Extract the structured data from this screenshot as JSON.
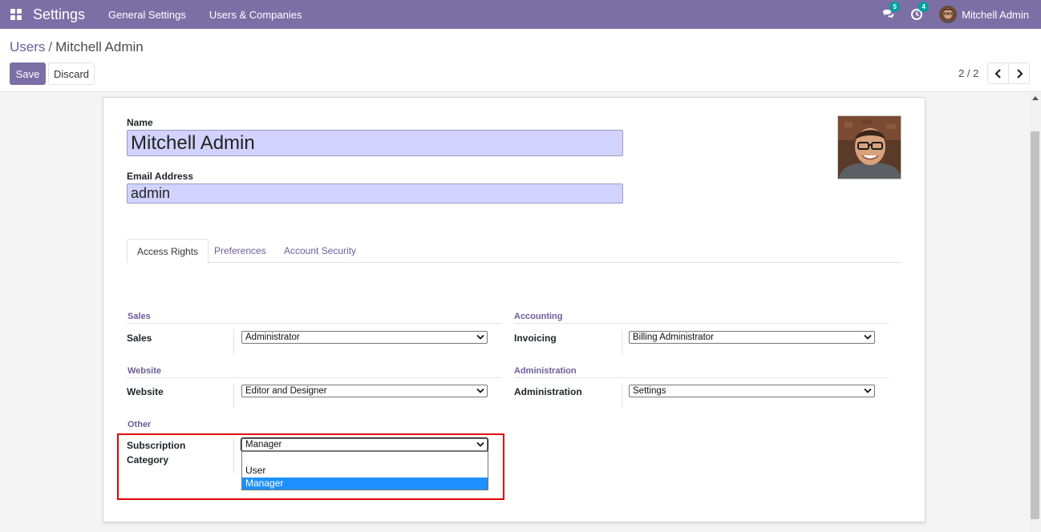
{
  "navbar": {
    "app_title": "Settings",
    "menus": [
      "General Settings",
      "Users & Companies"
    ],
    "messages_badge": "5",
    "activities_badge": "4",
    "user_name": "Mitchell Admin",
    "bg_color": "#7c6fa6"
  },
  "breadcrumb": {
    "parent": "Users",
    "separator": "/",
    "current": "Mitchell Admin"
  },
  "buttons": {
    "save": "Save",
    "discard": "Discard"
  },
  "pager": {
    "value": "2 / 2"
  },
  "form": {
    "name_label": "Name",
    "name_value": "Mitchell Admin",
    "email_label": "Email Address",
    "email_value": "admin"
  },
  "tabs": [
    "Access Rights",
    "Preferences",
    "Account Security"
  ],
  "groups": {
    "sales": {
      "title": "Sales",
      "label": "Sales",
      "value": "Administrator"
    },
    "accounting": {
      "title": "Accounting",
      "label": "Invoicing",
      "value": "Billing Administrator"
    },
    "website": {
      "title": "Website",
      "label": "Website",
      "value": "Editor and Designer"
    },
    "administration": {
      "title": "Administration",
      "label": "Administration",
      "value": "Settings"
    },
    "other": {
      "title": "Other",
      "label_line1": "Subscription",
      "label_line2": "Category",
      "value": "Manager",
      "options": [
        "",
        "User",
        "Manager"
      ],
      "selected_option": "Manager"
    }
  },
  "icons": {
    "apps": "apps-grid-icon",
    "messages": "chat-bubbles-icon",
    "activities": "clock-icon",
    "prev": "chevron-left-icon",
    "next": "chevron-right-icon",
    "dropdown": "chevron-down-icon"
  },
  "colors": {
    "accent": "#7c6fa6",
    "input_required_bg": "#d2d2ff",
    "highlight_border": "#e00000",
    "selected_option_bg": "#1e90ff"
  }
}
